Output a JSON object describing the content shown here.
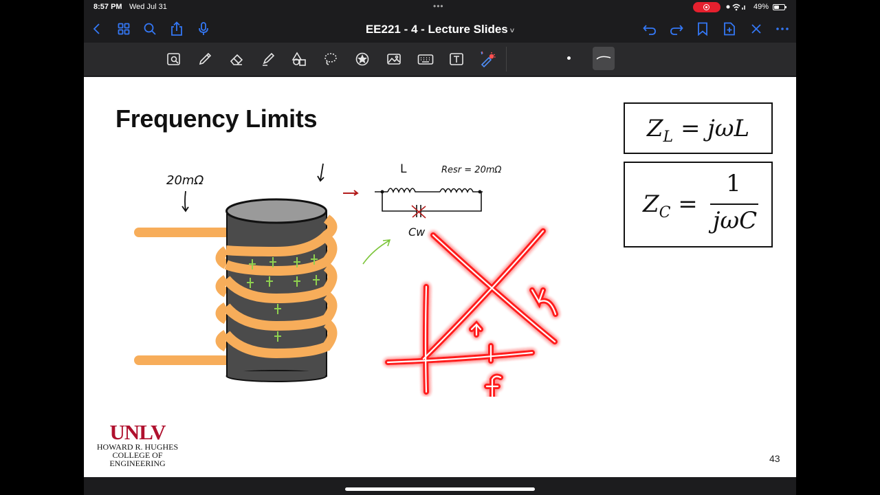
{
  "status_bar": {
    "time": "8:57 PM",
    "date": "Wed Jul 31",
    "multitask_dots": "•••",
    "battery_percent": "49%",
    "battery_level": 0.49
  },
  "nav": {
    "document_title": "EE221 - 4 - Lecture Slides",
    "title_caret": "˅"
  },
  "toolbar": {
    "tools": [
      "lasso-zoom",
      "pen",
      "eraser",
      "highlighter",
      "shapes",
      "lasso",
      "stickers",
      "image",
      "keyboard",
      "text",
      "laser-pointer"
    ],
    "stroke_width_options": [
      "dot",
      "curve"
    ]
  },
  "slide": {
    "title": "Frequency Limits",
    "eq1": {
      "lhs": "Z",
      "lhs_sub": "L",
      "rhs": " = jωL"
    },
    "eq2": {
      "lhs": "Z",
      "lhs_sub": "C",
      "eq": " = ",
      "numerator": "1",
      "denominator": "jωC"
    },
    "annotations": {
      "left_resistance": "20mΩ",
      "inductor": "L",
      "resr": "Resr = 20mΩ",
      "cap": "Cw",
      "axis_f": "f"
    },
    "logo": {
      "main": "UNLV",
      "line1": "HOWARD R. HUGHES",
      "line2": "COLLEGE OF",
      "line3": "ENGINEERING"
    },
    "page_number": "43"
  },
  "colors": {
    "accent": "#3478f6",
    "coil": "#f7ad5a",
    "core": "#4b4b4b",
    "laser": "#ff1a1a",
    "green_ink": "#7cc53a",
    "red_ink": "#b31b1b"
  }
}
